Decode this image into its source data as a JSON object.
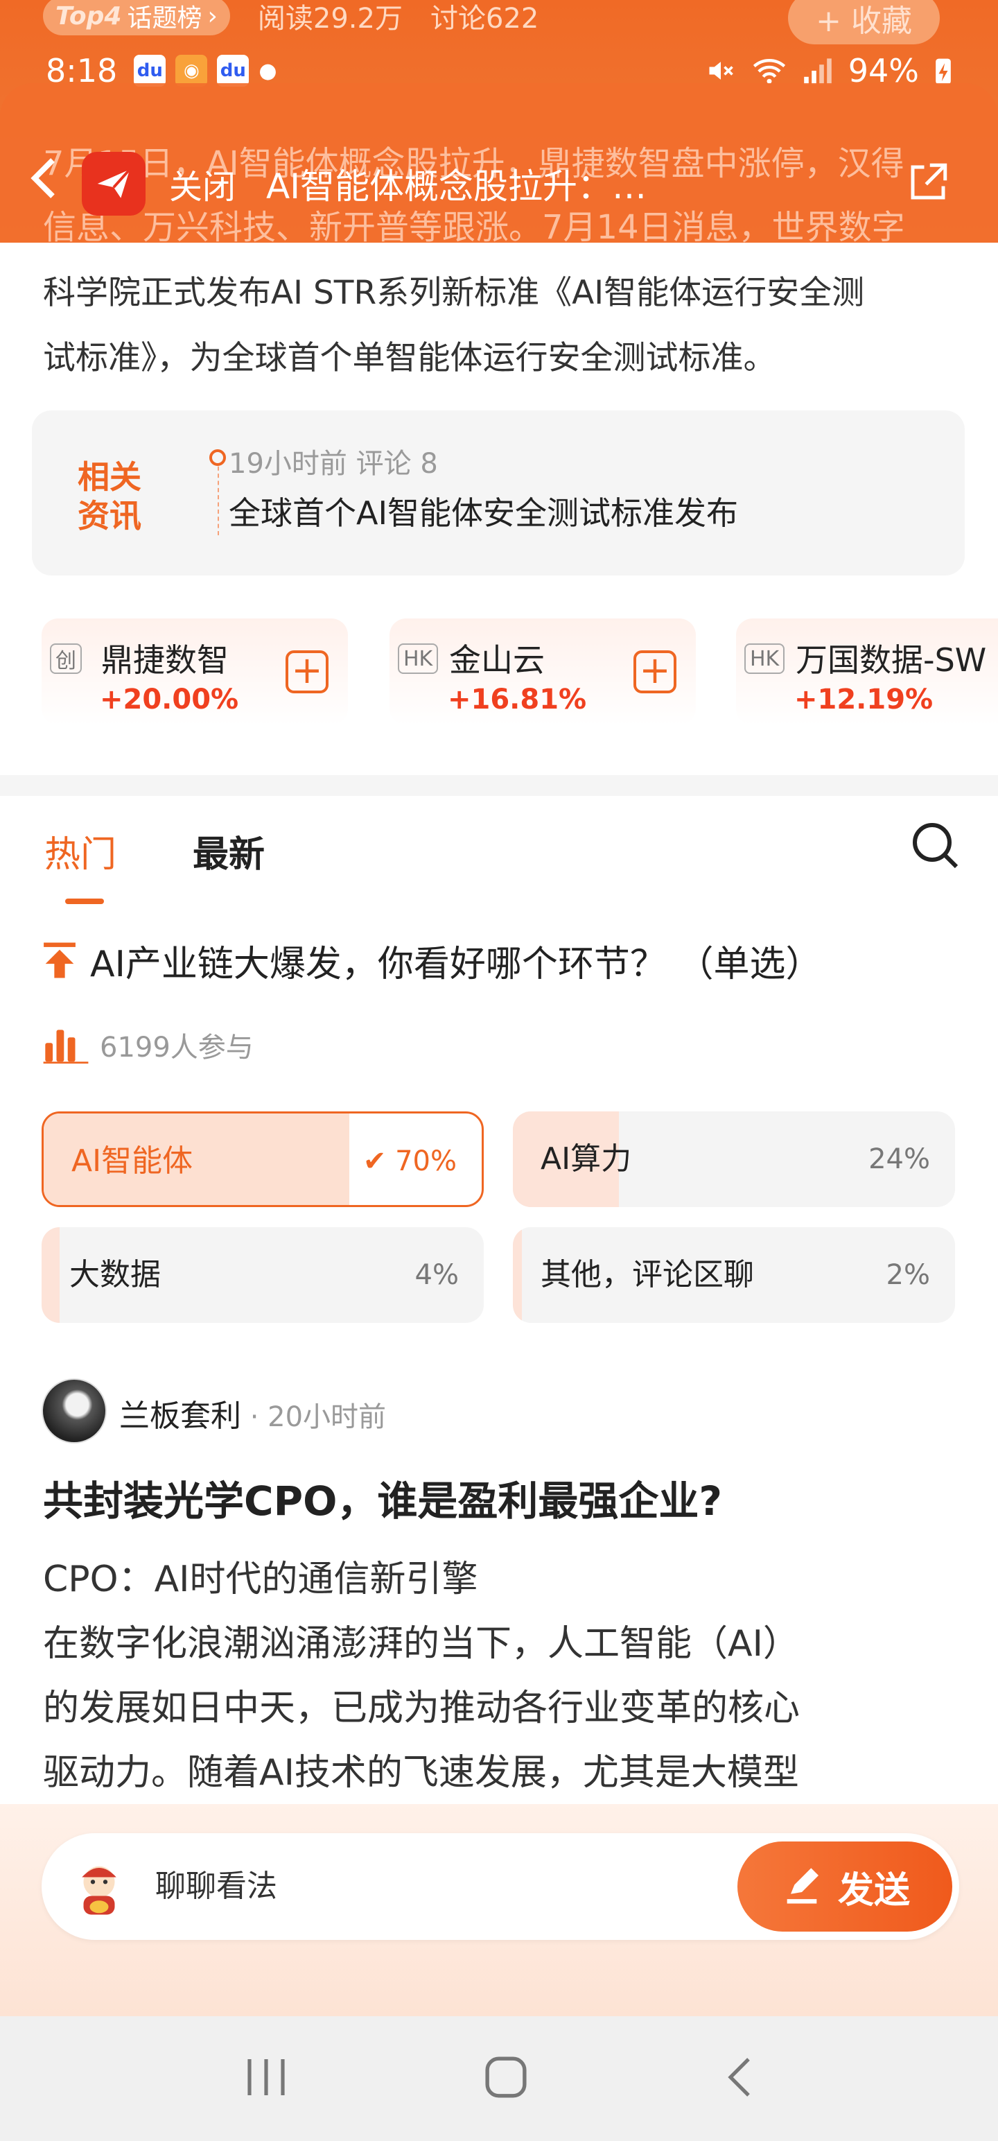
{
  "hero": {
    "top_badge": "Top4",
    "top_label": "话题榜",
    "reads": "阅读29.2万",
    "discussions": "讨论622",
    "collect_label": "+ 收藏"
  },
  "statusbar": {
    "time": "8:18",
    "battery": "94%"
  },
  "nav": {
    "close_label": "关闭",
    "title": "AI智能体概念股拉升：…",
    "faded_line1": "7月15日，AI智能体概念股拉升，鼎捷数智盘中涨停，汉得",
    "faded_line2": "信息、万兴科技、新开普等跟涨。7月14日消息，世界数字"
  },
  "summary": {
    "line1": "科学院正式发布AI STR系列新标准《AI智能体运行安全测",
    "line2": "试标准》，为全球首个单智能体运行安全测试标准。"
  },
  "related": {
    "badge_line1": "相关",
    "badge_line2": "资讯",
    "meta": "19小时前 评论 8",
    "title": "全球首个AI智能体安全测试标准发布"
  },
  "stocks": [
    {
      "market": "创",
      "name": "鼎捷数智",
      "change": "+20.00%"
    },
    {
      "market": "HK",
      "name": "金山云",
      "change": "+16.81%"
    },
    {
      "market": "HK",
      "name": "万国数据-SW",
      "change": "+12.19%"
    }
  ],
  "tabs": {
    "hot": "热门",
    "new": "最新"
  },
  "poll": {
    "question": "AI产业链大爆发，你看好哪个环节？ （单选）",
    "participants": "6199人参与",
    "options": [
      {
        "label": "AI智能体",
        "percent": "✔ 70%",
        "share": 0.7,
        "selected": true
      },
      {
        "label": "AI算力",
        "percent": "24%",
        "share": 0.24,
        "selected": false
      },
      {
        "label": "大数据",
        "percent": "4%",
        "share": 0.04,
        "selected": false
      },
      {
        "label": "其他，评论区聊",
        "percent": "2%",
        "share": 0.02,
        "selected": false
      }
    ]
  },
  "post": {
    "author": "兰板套利",
    "time": " · 20小时前",
    "title": "共封装光学CPO，谁是盈利最强企业?",
    "line1": "CPO：AI时代的通信新引擎",
    "line2": "在数字化浪潮汹涌澎湃的当下，人工智能（AI）",
    "line3": "的发展如日中天，已成为推动各行业变革的核心",
    "line4": "驱动力。随着AI技术的飞速发展，尤其是大模型"
  },
  "comment": {
    "placeholder": "聊聊看法",
    "send_label": "发送"
  },
  "colors": {
    "accent": "#ef6622",
    "rise": "#f0401f",
    "header": "#f06a26"
  }
}
